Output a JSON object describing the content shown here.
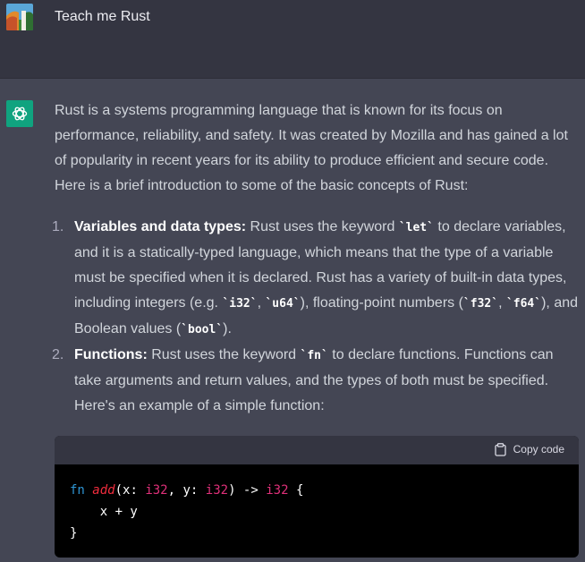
{
  "user": {
    "prompt": "Teach me Rust"
  },
  "assistant": {
    "intro": "Rust is a systems programming language that is known for its focus on performance, reliability, and safety. It was created by Mozilla and has gained a lot of popularity in recent years for its ability to produce efficient and secure code. Here is a brief introduction to some of the basic concepts of Rust:",
    "items": [
      {
        "num": "1.",
        "title": "Variables and data types:",
        "t1": " Rust uses the keyword ",
        "c1": "`let`",
        "t2": " to declare variables, and it is a statically-typed language, which means that the type of a variable must be specified when it is declared. Rust has a variety of built-in data types, including integers (e.g. ",
        "c2": "`i32`",
        "t3": ", ",
        "c3": "`u64`",
        "t4": "), floating-point numbers (",
        "c4": "`f32`",
        "t5": ", ",
        "c5": "`f64`",
        "t6": "), and Boolean values (",
        "c6": "`bool`",
        "t7": ")."
      },
      {
        "num": "2.",
        "title": "Functions:",
        "t1": " Rust uses the keyword ",
        "c1": "`fn`",
        "t2": " to declare functions. Functions can take arguments and return values, and the types of both must be specified. Here's an example of a simple function:"
      }
    ],
    "code": {
      "copy_label": "Copy code",
      "tokens": {
        "kw_fn": "fn",
        "sp1": " ",
        "fname": "add",
        "p1": "(x: ",
        "ty1": "i32",
        "p2": ", y: ",
        "ty2": "i32",
        "p3": ") -> ",
        "ty3": "i32",
        "p4": " {",
        "line2": "    x + y",
        "line3": "}"
      }
    }
  },
  "colors": {
    "user_bg": "#343541",
    "assistant_bg": "#444654",
    "bot_avatar": "#10a37f",
    "keyword": "#2e95d3",
    "function_name": "#f22c3d",
    "type": "#df3079"
  },
  "icons": {
    "user_avatar": "user-avatar-landscape",
    "bot_avatar": "openai-logo-icon",
    "copy": "clipboard-icon"
  }
}
